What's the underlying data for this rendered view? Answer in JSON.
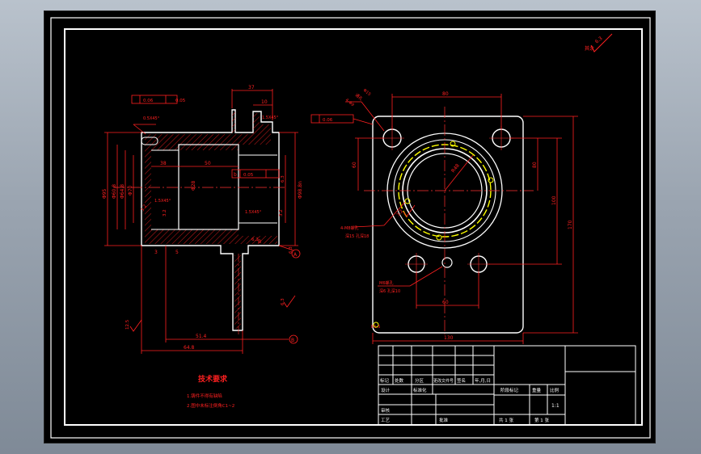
{
  "colors": {
    "background": "#000000",
    "outline": "#ffffff",
    "dimension": "#ff2020",
    "centerline": "#ff3030",
    "thread": "#ffff00",
    "hatch": "#ff2020"
  },
  "drawing": {
    "surface_finish": {
      "value": "6.3",
      "label": "其余"
    },
    "left_view": {
      "dims": {
        "top_37": "37",
        "top_10": "10",
        "top_chamfer": "1.5X45°",
        "chamfer_left": "0.5X45°",
        "tol_frame_1": "0.06",
        "tol_frame_2": "0.05",
        "tol_frame_3": "0.05",
        "tol_frame_b": "b",
        "dia_left_1": "Φ95",
        "dia_left_2": "Φ60.8",
        "dia_left_3": "Φ64.8",
        "dia_left_4": "Φ70",
        "inner_38": "38",
        "inner_50": "50",
        "bore": "Φ28",
        "chamfer_in_1": "1.5X45°",
        "chamfer_in_2": "1.5X45°",
        "rough_1": "3.2",
        "rough_2": "3.2",
        "rough_3": "3.2",
        "rough_4": "6.3",
        "rough_5": "6.3",
        "rough_6": "12.5",
        "rough_7": "6.3",
        "rough_8": "6.3",
        "dia_right": "Φ98.8n",
        "dim_3": "3",
        "dim_5": "5",
        "dim_b": "B",
        "len_1": "51.4",
        "len_2": "64.8",
        "datum": "B",
        "datum_a": "A"
      }
    },
    "right_view": {
      "dims": {
        "top_80": "80",
        "tol_frame": "0.06",
        "holes_label_1": "4-Φ9",
        "holes_label_2": "通孔",
        "holes_label_3": "Φ15",
        "side_60": "60",
        "side_80": "80",
        "side_100": "100",
        "side_170": "170",
        "r": "R48",
        "thread_label_1": "4-M8螺孔",
        "thread_label_2": "深15 孔深18",
        "rough": "3.2",
        "bottom_label_1": "M6螺孔",
        "bottom_label_2": "深6 孔深10",
        "dim_60": "60",
        "dim_130": "130",
        "chamfer": "R1.5"
      }
    },
    "tech_notes": {
      "title": "技术要求",
      "lines": [
        "1.铸件不得有缺陷",
        "2.图中未标注倒角C1~2"
      ]
    },
    "title_block": {
      "row_labels": [
        "标记",
        "处数",
        "分区",
        "更改文件号",
        "签名",
        "年,月,日"
      ],
      "design_labels": [
        "设计",
        "标准化",
        "审核",
        "工艺",
        "批准"
      ],
      "scale_header": [
        "阶段标记",
        "重量",
        "比例"
      ],
      "scale_value": "1:1",
      "sheet_total": "共 1 张",
      "sheet_no": "第 1 张"
    }
  }
}
